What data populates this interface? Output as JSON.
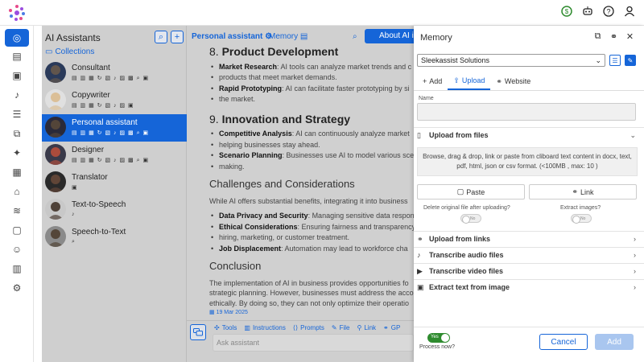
{
  "header": {
    "icons": [
      "dollar-circle-icon",
      "robot-icon",
      "help-icon",
      "user-icon"
    ],
    "accent": "#1565d8"
  },
  "rail": {
    "icons": [
      "brain-icon",
      "database-icon",
      "images-icon",
      "microphone-icon",
      "checklist-icon",
      "copy-icon",
      "sparkles-icon",
      "chart-icon",
      "bank-icon",
      "layers-icon",
      "chat-icon",
      "users-icon",
      "server-icon",
      "gear-icon"
    ]
  },
  "assistants": {
    "title": "AI Assistants",
    "collections_label": "Collections",
    "items": [
      {
        "name": "Consultant",
        "tools": "▤ ▥ ▦ ↻ ▧ ♪ ▨ ▩ ⌕ ▣"
      },
      {
        "name": "Copywriter",
        "tools": "▤ ▥ ▦ ↻ ▧ ♪ ▨ ▣"
      },
      {
        "name": "Personal assistant",
        "tools": "▤ ▥ ▦ ↻ ▧ ♪ ▨ ▩ ⌕ ▣"
      },
      {
        "name": "Designer",
        "tools": "▤ ▥ ▦ ↻ ▧ ♪ ▨ ▩ ⌕ ▣"
      },
      {
        "name": "Translator",
        "tools": "▣"
      },
      {
        "name": "Text-to-Speech",
        "tools": "♪"
      },
      {
        "name": "Speech-to-Text",
        "tools": "⌕"
      }
    ]
  },
  "content": {
    "tab_assistant": "Personal assistant",
    "tab_memory": "Memory",
    "about_button": "About AI in",
    "h_product": "8.",
    "h_product_b": "Product Development",
    "li_market_b": "Market Research",
    "li_market_1": ": AI tools can analyze market trends and c",
    "li_market_2": "products that meet market demands.",
    "li_proto_b": "Rapid Prototyping",
    "li_proto_1": ": AI can facilitate faster prototyping by si",
    "li_proto_2": "the market.",
    "h_innov": "9.",
    "h_innov_b": "Innovation and Strategy",
    "li_comp_b": "Competitive Analysis",
    "li_comp_1": ": AI can continuously analyze market",
    "li_comp_2": "helping businesses stay ahead.",
    "li_scen_b": "Scenario Planning",
    "li_scen_1": ": Businesses use AI to model various sce",
    "li_scen_2": "making.",
    "h_challenges": "Challenges and Considerations",
    "p_challenges": "While AI offers substantial benefits, integrating it into business",
    "li_data_b": "Data Privacy and Security",
    "li_data_1": ": Managing sensitive data respon",
    "li_eth_b": "Ethical Considerations",
    "li_eth_1": ": Ensuring fairness and transparency",
    "li_eth_2": "hiring, marketing, or customer treatment.",
    "li_job_b": "Job Displacement",
    "li_job_1": ": Automation may lead to workforce cha",
    "h_conclusion": "Conclusion",
    "p_c1": "The implementation of AI in business provides opportunities fo",
    "p_c2": "strategic planning. However, businesses must address the acco",
    "p_c3": "ethically. By doing so, they can not only optimize their operatio",
    "date": "19 Mar 2025"
  },
  "composer": {
    "tools": [
      "Tools",
      "Instructions",
      "Prompts",
      "File",
      "Link",
      "GP"
    ],
    "placeholder": "Ask assistant"
  },
  "memory": {
    "title": "Memory",
    "selected": "Sleekassist Solutions",
    "tabs": [
      "Add",
      "Upload",
      "Website"
    ],
    "name_label": "Name",
    "upload_files": "Upload from files",
    "drop_line1": "Browse, drag & drop, link or paste from cliboard text content in docx, text,",
    "drop_line2": "pdf, html, json or csv format. (<100MB , max: 10 )",
    "paste": "Paste",
    "link": "Link",
    "delete_q": "Delete original file after uploading?",
    "extract_q": "Extract images?",
    "no": "No",
    "upload_links": "Upload from links",
    "transcribe_audio": "Transcribe audio files",
    "transcribe_video": "Transcribe video files",
    "extract_text": "Extract text from image",
    "yes": "Yes",
    "process": "Process now?",
    "cancel": "Cancel",
    "add": "Add"
  }
}
